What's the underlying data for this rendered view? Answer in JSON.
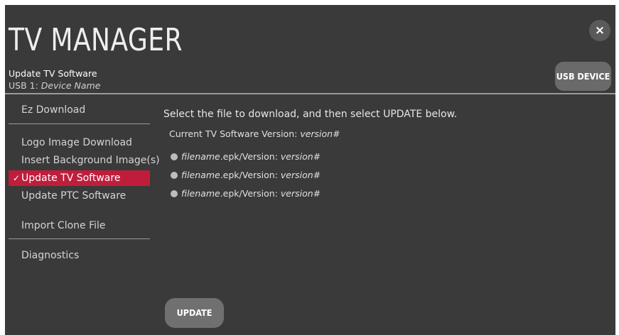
{
  "header": {
    "title": "TV MANAGER",
    "close_icon": "×",
    "section_title": "Update TV Software",
    "device_prefix": "USB 1: ",
    "device_name": "Device Name",
    "usb_device_button": "USB DEVICE"
  },
  "sidebar": {
    "items": [
      {
        "label": "Ez Download",
        "active": false
      },
      {
        "label": "Logo Image Download",
        "active": false
      },
      {
        "label": "Insert Background Image(s)",
        "active": false
      },
      {
        "label": "Update TV Software",
        "active": true,
        "icon": "check-icon",
        "icon_glyph": "✓"
      },
      {
        "label": "Update PTC Software",
        "active": false
      },
      {
        "label": "Import Clone File",
        "active": false
      },
      {
        "label": "Diagnostics",
        "active": false
      }
    ]
  },
  "main": {
    "instruction": "Select the file to download, and then select UPDATE below.",
    "current_version_label": "Current TV Software Version: ",
    "current_version_value": "version#",
    "files": [
      {
        "filename": "filename",
        "suffix": ".epk/Version: ",
        "version": "version#"
      },
      {
        "filename": "filename",
        "suffix": ".epk/Version: ",
        "version": "version#"
      },
      {
        "filename": "filename",
        "suffix": ".epk/Version: ",
        "version": "version#"
      }
    ],
    "update_button": "UPDATE"
  },
  "colors": {
    "background": "#3b3a3a",
    "active_item": "#c01d3c",
    "button": "#6a6a6a",
    "divider": "#9a9a9a"
  }
}
